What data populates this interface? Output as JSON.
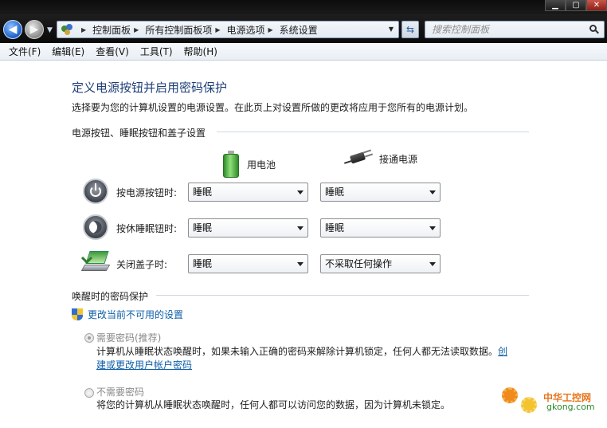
{
  "window": {
    "controls": [
      "▁",
      "▢",
      "✕"
    ]
  },
  "address_bar": {
    "crumbs": [
      "控制面板",
      "所有控制面板项",
      "电源选项",
      "系统设置"
    ]
  },
  "search": {
    "placeholder": "搜索控制面板"
  },
  "menu": {
    "items": [
      "文件(F)",
      "编辑(E)",
      "查看(V)",
      "工具(T)",
      "帮助(H)"
    ]
  },
  "page": {
    "title": "定义电源按钮并启用密码保护",
    "description": "选择要为您的计算机设置的电源设置。在此页上对设置所做的更改将应用于您所有的电源计划。"
  },
  "power_section": {
    "heading": "电源按钮、睡眠按钮和盖子设置",
    "columns": [
      "用电池",
      "接通电源"
    ],
    "rows": [
      {
        "label": "按电源按钮时:",
        "battery": "睡眠",
        "plugged": "睡眠"
      },
      {
        "label": "按休睡眠钮时:",
        "battery": "睡眠",
        "plugged": "睡眠"
      },
      {
        "label": "关闭盖子时:",
        "battery": "睡眠",
        "plugged": "不采取任何操作"
      }
    ]
  },
  "password_section": {
    "heading": "唤醒时的密码保护",
    "change_link": "更改当前不可用的设置",
    "option_require": {
      "label": "需要密码(推荐)",
      "desc": "计算机从睡眠状态唤醒时，如果未输入正确的密码来解除计算机锁定，任何人都无法读取数据。",
      "link_part1": "创",
      "link_part2": "建或更改用户帐户密码"
    },
    "option_none": {
      "label": "不需要密码",
      "desc": "将您的计算机从睡眠状态唤醒时，任何人都可以访问您的数据，因为计算机未锁定。"
    }
  },
  "watermark": {
    "cn": "中华工控网",
    "en": "gkong.com"
  }
}
